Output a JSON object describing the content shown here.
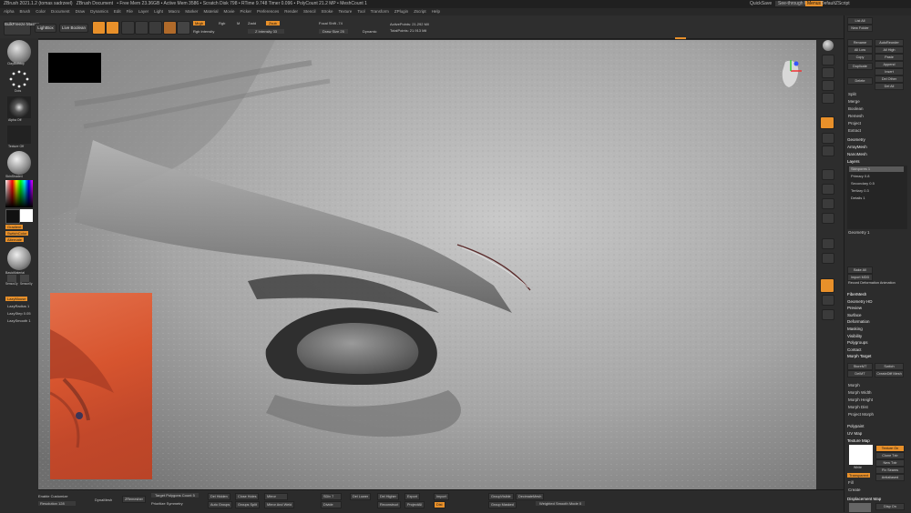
{
  "titlebar": {
    "title": "ZBrush 2021.1.2 (tomas sadrzeel)",
    "doc": "ZBrush Document",
    "stats": "• Free Mem 23.36GB • Active Mem 3586 • Scratch Disk 798 • RTime 9.748 Timer 0.096 • PolyCount 21.2 MP • MeshCount 1",
    "menus_label": "Menus",
    "quicksave": "QuickSave",
    "seethrough": "See-through 0",
    "script": "DefaultZScript"
  },
  "menubar": [
    "Alpha",
    "Brush",
    "Color",
    "Document",
    "Draw",
    "Dynamics",
    "Edit",
    "File",
    "Layer",
    "Light",
    "Macro",
    "Marker",
    "Material",
    "Movie",
    "Picker",
    "Preferences",
    "Render",
    "Stencil",
    "Stroke",
    "Texture",
    "Tool",
    "Transform",
    "ZPlugin",
    "Zscript",
    "Help"
  ],
  "topshelf": {
    "bulkfreeze": "BulkFreeze Master",
    "lightbox": "LightBox",
    "livebool": "Live Boolean",
    "edit": "Edit",
    "draw": "Draw",
    "move": "Move",
    "scale": "Scale",
    "rotate": "Rotate",
    "mrgb": "Mrgb",
    "rgb": "Rgb",
    "m": "M",
    "zadd": "Zadd",
    "zsub": "Zsub",
    "rgb_intensity": "Rgb Intensity",
    "z_intensity": "Z Intensity 33",
    "focal_shift": "Focal Shift -74",
    "draw_size": "Draw Size 25",
    "dynamic": "Dynamic",
    "active_points": "ActivePoints: 21.292 Mil",
    "total_points": "TotalPoints: 21.913 Mil"
  },
  "coords": "0.235,0.588,0.597",
  "lefttray": {
    "brush_label": "ClayBuildup",
    "dots_label": "Dots",
    "alpha_label": "Alpha Off",
    "texture_label": "Texture Off",
    "material_label": "SkinShade4",
    "gradient": "Gradient",
    "switch_color": "SwitchColor",
    "alternate": "Alternate",
    "material2_label": "BasicMaterial",
    "sensor1": "Sensor2y",
    "sensor2": "Sensor0y",
    "lazymouse": "LazyMouse",
    "lazyradius": "LazyRadius 1",
    "lazystep": "LazyStep 0.05",
    "lazysmooth": "LazySmooth 1"
  },
  "rightpanel": {
    "items": [
      "List All",
      "New Folder",
      "Rename",
      "AutoReorder",
      "All Low",
      "All High",
      "Copy",
      "Paste",
      "Duplicate",
      "Append",
      "Insert",
      "Delete",
      "Del Other",
      "Del All",
      "Split",
      "Merge",
      "Boolean",
      "Remesh",
      "Project",
      "Extract"
    ],
    "geometry": "Geometry",
    "arraymesh": "ArrayMesh",
    "nanomesh": "NanoMesh",
    "layers": "Layers",
    "layer_rows": [
      "Skinpores 1",
      "Primary 0.8",
      "Secondary 0.5",
      "Tertiary 0.3",
      "Details 1"
    ],
    "layer_footer": "Geometry 1",
    "bake_all": "Bake All",
    "import_mdd": "Import MDD",
    "record_anim": "Record Deformation Animation",
    "sections": [
      "FiberMesh",
      "Geometry HD",
      "Preview",
      "Surface",
      "Deformation",
      "Masking",
      "Visibility",
      "Polygroups",
      "Contact",
      "Morph Target"
    ],
    "morph_btns": [
      "StoreMT",
      "Switch",
      "DelMT",
      "CreateDiff Mesh"
    ],
    "morph_sliders": [
      "Morph",
      "Morph Width",
      "Morph Height",
      "Morph Dist"
    ],
    "project_morph": "Project Morph",
    "polypaint": "Polypaint",
    "uvmap": "UV Map",
    "texture_map": "Texture Map",
    "tm_btns": [
      "Texture On",
      "Clone Txtr",
      "New Txtr",
      "Fix Seams",
      "Antialiased"
    ],
    "tm_label": "White",
    "transparent": "Transparent",
    "fill": "Fill",
    "create": "Create",
    "displacement": "Displacement Map",
    "dm_btns": [
      "Disp On",
      "Clone Disp"
    ]
  },
  "bottom": {
    "enable_customize": "Enable Customize",
    "resolution": "Resolution 128",
    "dynamesh": "DynaMesh",
    "zremesher": "ZRemesher",
    "target_poly": "Target Polygons Count 5",
    "half": "Half",
    "adapt": "Adapt",
    "same": "Same",
    "double": "Double",
    "prioritize": "Prioritize Symmetry",
    "del_hidden": "Del Hidden",
    "close_holes": "Close Holes",
    "auto_groups": "Auto Groups",
    "groups_split": "Groups Split",
    "mirror": "Mirror",
    "mirror_weld": "Mirror And Weld",
    "del_lower": "Del Lower",
    "del_higher": "Del Higher",
    "sdiv": "SDiv 7",
    "divide": "Divide",
    "reconstruct": "Reconstruct",
    "export": "Export",
    "import": "Import",
    "project_all": "ProjectAll",
    "dist": "Dist",
    "group_visible": "GroupVisible",
    "group_masked": "Group Masked",
    "decimate": "DecimateMesh",
    "weighted": "Weighted Smooth Mode 0",
    "dynamic_label": "Dynamic",
    "unmask": "UnMask"
  },
  "colors": {
    "accent": "#e8902a",
    "panel": "#2c2c2c",
    "viewport_bg": "#8a8a8a"
  }
}
